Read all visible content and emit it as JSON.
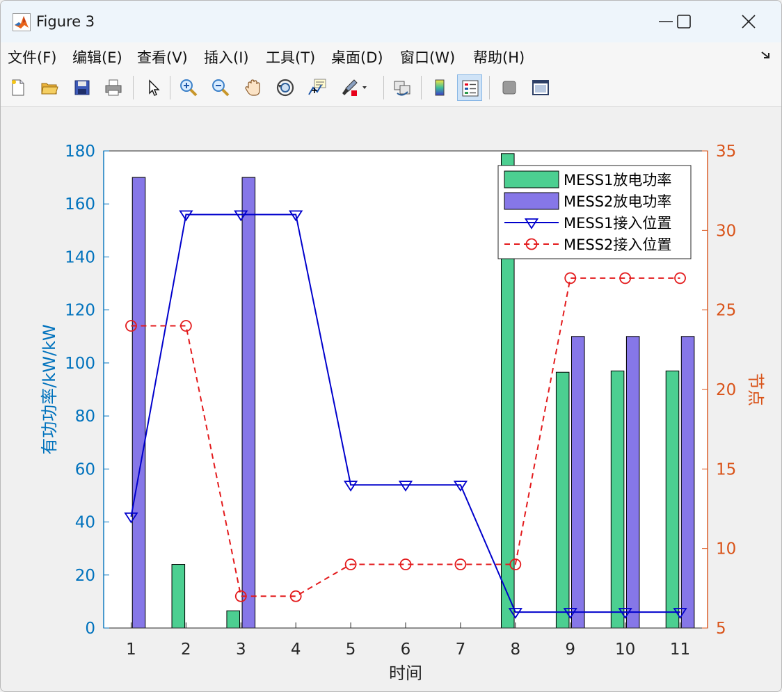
{
  "window": {
    "title": "Figure 3",
    "colors": {
      "titlebar": "#eef5fb",
      "background": "#f0f0f0"
    }
  },
  "menu": [
    {
      "label": "文件(F)"
    },
    {
      "label": "编辑(E)"
    },
    {
      "label": "查看(V)"
    },
    {
      "label": "插入(I)"
    },
    {
      "label": "工具(T)"
    },
    {
      "label": "桌面(D)"
    },
    {
      "label": "窗口(W)"
    },
    {
      "label": "帮助(H)"
    }
  ],
  "toolbar": [
    {
      "icon": "new-figure-icon"
    },
    {
      "icon": "open-file-icon"
    },
    {
      "icon": "save-icon"
    },
    {
      "icon": "print-icon"
    },
    {
      "icon": "pointer-icon"
    },
    {
      "icon": "zoom-in-icon"
    },
    {
      "icon": "zoom-out-icon"
    },
    {
      "icon": "pan-icon"
    },
    {
      "icon": "rotate-3d-icon"
    },
    {
      "icon": "data-cursor-icon"
    },
    {
      "icon": "brush-icon"
    },
    {
      "icon": "link-plot-icon"
    },
    {
      "icon": "colorbar-icon"
    },
    {
      "icon": "legend-icon"
    },
    {
      "icon": "hide-plot-tools-icon"
    },
    {
      "icon": "show-plot-tools-icon"
    }
  ],
  "chart_data": {
    "type": "bar",
    "xlabel": "时间",
    "ylabel_left": "有功功率/kW/kW",
    "ylabel_right": "节点",
    "x": [
      1,
      2,
      3,
      4,
      5,
      6,
      7,
      8,
      9,
      10,
      11
    ],
    "ylim_left": [
      0,
      180
    ],
    "yticks_left": [
      0,
      20,
      40,
      60,
      80,
      100,
      120,
      140,
      160,
      180
    ],
    "ylim_right": [
      5,
      35
    ],
    "yticks_right": [
      5,
      10,
      15,
      20,
      25,
      30,
      35
    ],
    "grid": false,
    "legend_position": "top-right",
    "series": [
      {
        "name": "MESS1放电功率",
        "kind": "bar",
        "axis": "left",
        "color": "#4ccf91",
        "values": [
          0,
          24,
          6.5,
          0,
          0,
          0,
          0,
          179,
          96.5,
          97,
          97
        ]
      },
      {
        "name": "MESS2放电功率",
        "kind": "bar",
        "axis": "left",
        "color": "#8677e8",
        "values": [
          170,
          0,
          170,
          0,
          0,
          0,
          0,
          0,
          110,
          110,
          110
        ]
      },
      {
        "name": "MESS1接入位置",
        "kind": "line",
        "axis": "right",
        "color": "#0000cc",
        "marker": "triangle-down",
        "linestyle": "solid",
        "values": [
          12,
          31,
          31,
          31,
          14,
          14,
          14,
          6,
          6,
          6,
          6
        ]
      },
      {
        "name": "MESS2接入位置",
        "kind": "line",
        "axis": "right",
        "color": "#e31a1c",
        "marker": "circle",
        "linestyle": "dashed",
        "values": [
          24,
          24,
          7,
          7,
          9,
          9,
          9,
          9,
          27,
          27,
          27
        ]
      }
    ],
    "colors": {
      "left_axis": "#0072bd",
      "right_axis": "#d95319",
      "x_axis": "#262626"
    }
  }
}
